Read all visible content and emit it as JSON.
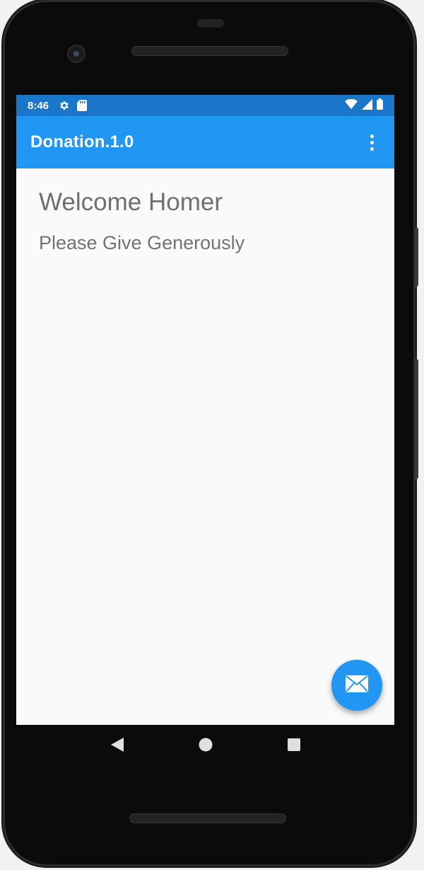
{
  "status_bar": {
    "time": "8:46",
    "left_icons": [
      "gear-icon",
      "sd-card-icon"
    ],
    "right_icons": [
      "wifi-icon",
      "signal-icon",
      "battery-icon"
    ]
  },
  "app_bar": {
    "title": "Donation.1.0",
    "overflow_icon": "more-vert-icon"
  },
  "content": {
    "welcome": "Welcome Homer",
    "subtitle": "Please Give Generously"
  },
  "fab": {
    "icon": "mail-icon"
  },
  "nav_bar": {
    "icons": [
      "back-icon",
      "home-icon",
      "recents-icon"
    ]
  },
  "colors": {
    "status_bar": "#1976c9",
    "app_bar": "#2196f3",
    "fab": "#2196f3",
    "screen_bg": "#fafafa",
    "text_gray": "#6f6f6f"
  }
}
